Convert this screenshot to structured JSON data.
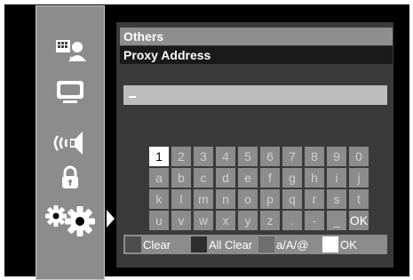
{
  "header": {
    "menu_title": "Others",
    "item_title": "Proxy Address"
  },
  "input": {
    "value": ""
  },
  "keyboard": {
    "rows": [
      [
        "1",
        "2",
        "3",
        "4",
        "5",
        "6",
        "7",
        "8",
        "9",
        "0"
      ],
      [
        "a",
        "b",
        "c",
        "d",
        "e",
        "f",
        "g",
        "h",
        "i",
        "j"
      ],
      [
        "k",
        "l",
        "m",
        "n",
        "o",
        "p",
        "q",
        "r",
        "s",
        "t"
      ],
      [
        "u",
        "v",
        "w",
        "x",
        "y",
        "z",
        ".",
        "-",
        "_",
        "OK"
      ]
    ],
    "selected": "1"
  },
  "legend": [
    {
      "label": "Clear",
      "color": "#4d4d4d"
    },
    {
      "label": "All Clear",
      "color": "#2e2e2e"
    },
    {
      "label": "a/A/@",
      "color": "#6e6e6e"
    },
    {
      "label": "OK",
      "color": "#ffffff"
    }
  ],
  "sidebar": {
    "icons": [
      "setup-guide-icon",
      "display-icon",
      "audio-icon",
      "lock-icon",
      "others-icon"
    ],
    "selected": "others-icon"
  },
  "colors": {
    "screen": "#000000",
    "sidebar": "#8c8c8c",
    "header_selected": "#8e8e8e",
    "panel": "#3a3a3a"
  }
}
